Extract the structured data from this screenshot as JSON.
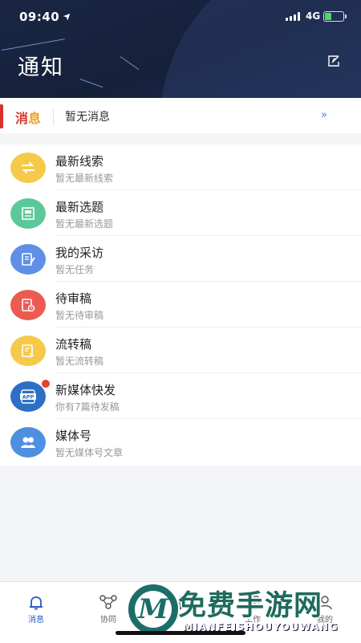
{
  "status_bar": {
    "time": "09:40",
    "location_glyph": "➤",
    "network": "4G",
    "battery_level": 0.38
  },
  "header": {
    "title": "通知",
    "edit_icon": "edit-icon"
  },
  "notice_bar": {
    "tag_part1": "消",
    "tag_part2": "息",
    "message": "暂无消息",
    "more_glyph": "»"
  },
  "items": [
    {
      "title": "最新线索",
      "subtitle": "暂无最新线索",
      "color": "#f5c94a",
      "icon": "swap-arrows-icon",
      "badge": false
    },
    {
      "title": "最新选题",
      "subtitle": "暂无最新选题",
      "color": "#5cc89a",
      "icon": "newspaper-icon",
      "badge": false
    },
    {
      "title": "我的采访",
      "subtitle": "暂无任务",
      "color": "#5f8fe6",
      "icon": "interview-icon",
      "badge": false
    },
    {
      "title": "待审稿",
      "subtitle": "暂无待审稿",
      "color": "#ec5b52",
      "icon": "review-doc-icon",
      "badge": false
    },
    {
      "title": "流转稿",
      "subtitle": "暂无流转稿",
      "color": "#f5c94a",
      "icon": "transfer-doc-icon",
      "badge": false
    },
    {
      "title": "新媒体快发",
      "subtitle": "你有7篇待发稿",
      "color": "#2d6fc4",
      "icon": "app-icon",
      "app_text": "APP",
      "badge": true
    },
    {
      "title": "媒体号",
      "subtitle": "暂无媒体号文章",
      "color": "#4f8fe0",
      "icon": "group-icon",
      "badge": false
    }
  ],
  "tabbar": {
    "tabs": [
      {
        "label": "消息",
        "icon": "bell-icon",
        "active": true
      },
      {
        "label": "协同",
        "icon": "collab-icon",
        "active": false
      },
      {
        "label": "",
        "icon": "plus-icon",
        "active": false
      },
      {
        "label": "工作",
        "icon": "work-icon",
        "active": false
      },
      {
        "label": "我的",
        "icon": "profile-icon",
        "active": false
      }
    ]
  },
  "watermark": {
    "logo_letter": "M",
    "text_cn": "免费手游网",
    "text_en": "MIANFEISHOUYOUWANG"
  }
}
